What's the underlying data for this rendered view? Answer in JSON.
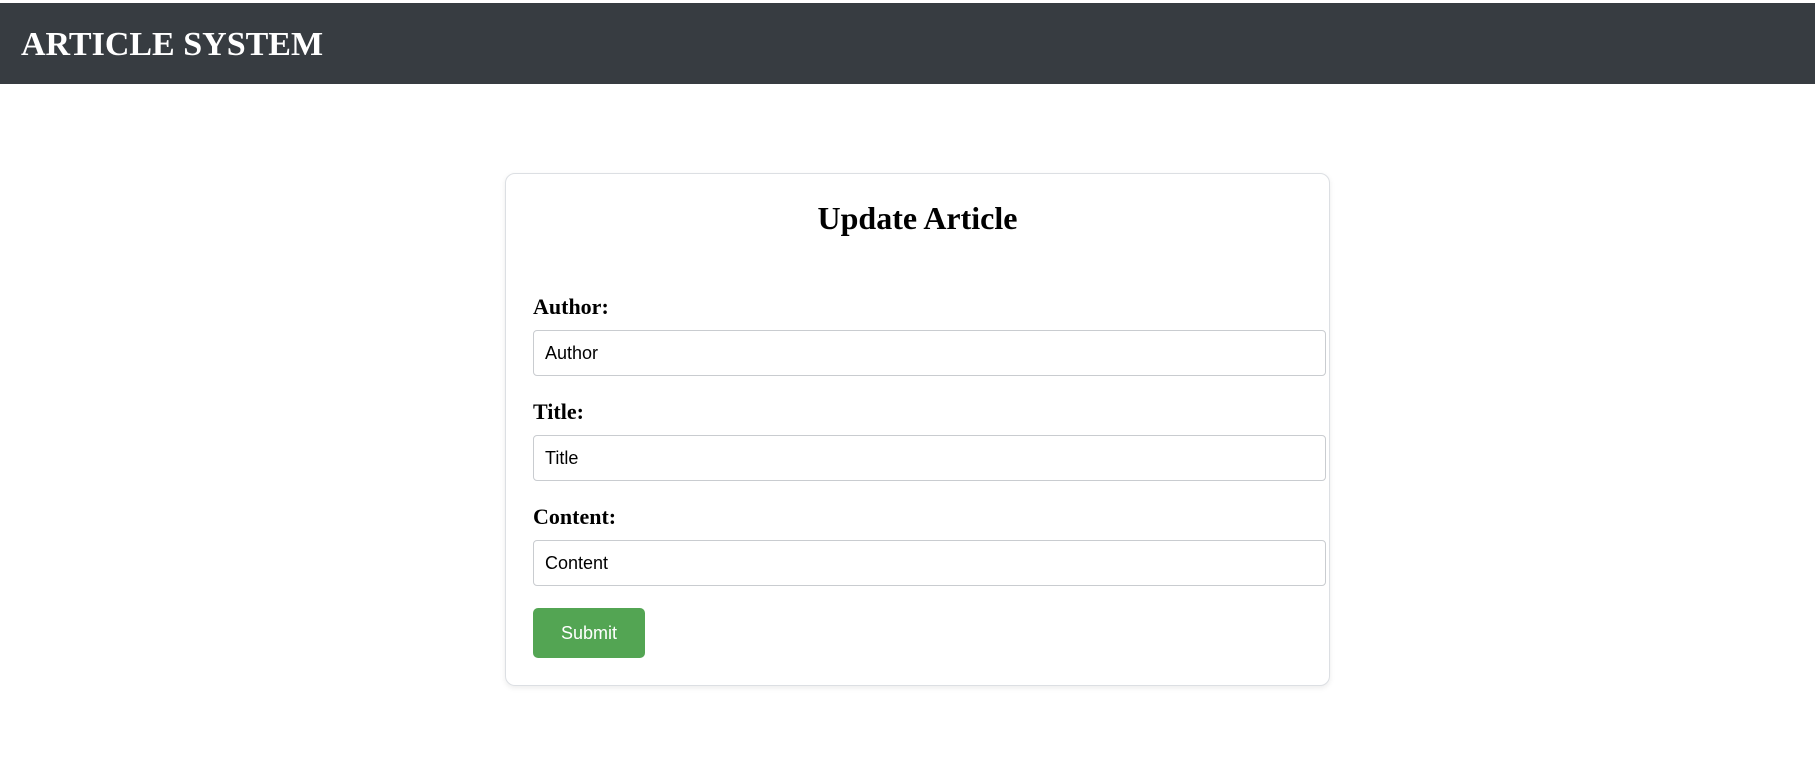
{
  "header": {
    "title": "ARTICLE SYSTEM"
  },
  "form": {
    "title": "Update Article",
    "fields": [
      {
        "label": "Author:",
        "value": "Author"
      },
      {
        "label": "Title:",
        "value": "Title"
      },
      {
        "label": "Content:",
        "value": "Content"
      }
    ],
    "submit_label": "Submit"
  },
  "colors": {
    "header_bg": "#373c41",
    "submit_bg": "#53a553"
  }
}
